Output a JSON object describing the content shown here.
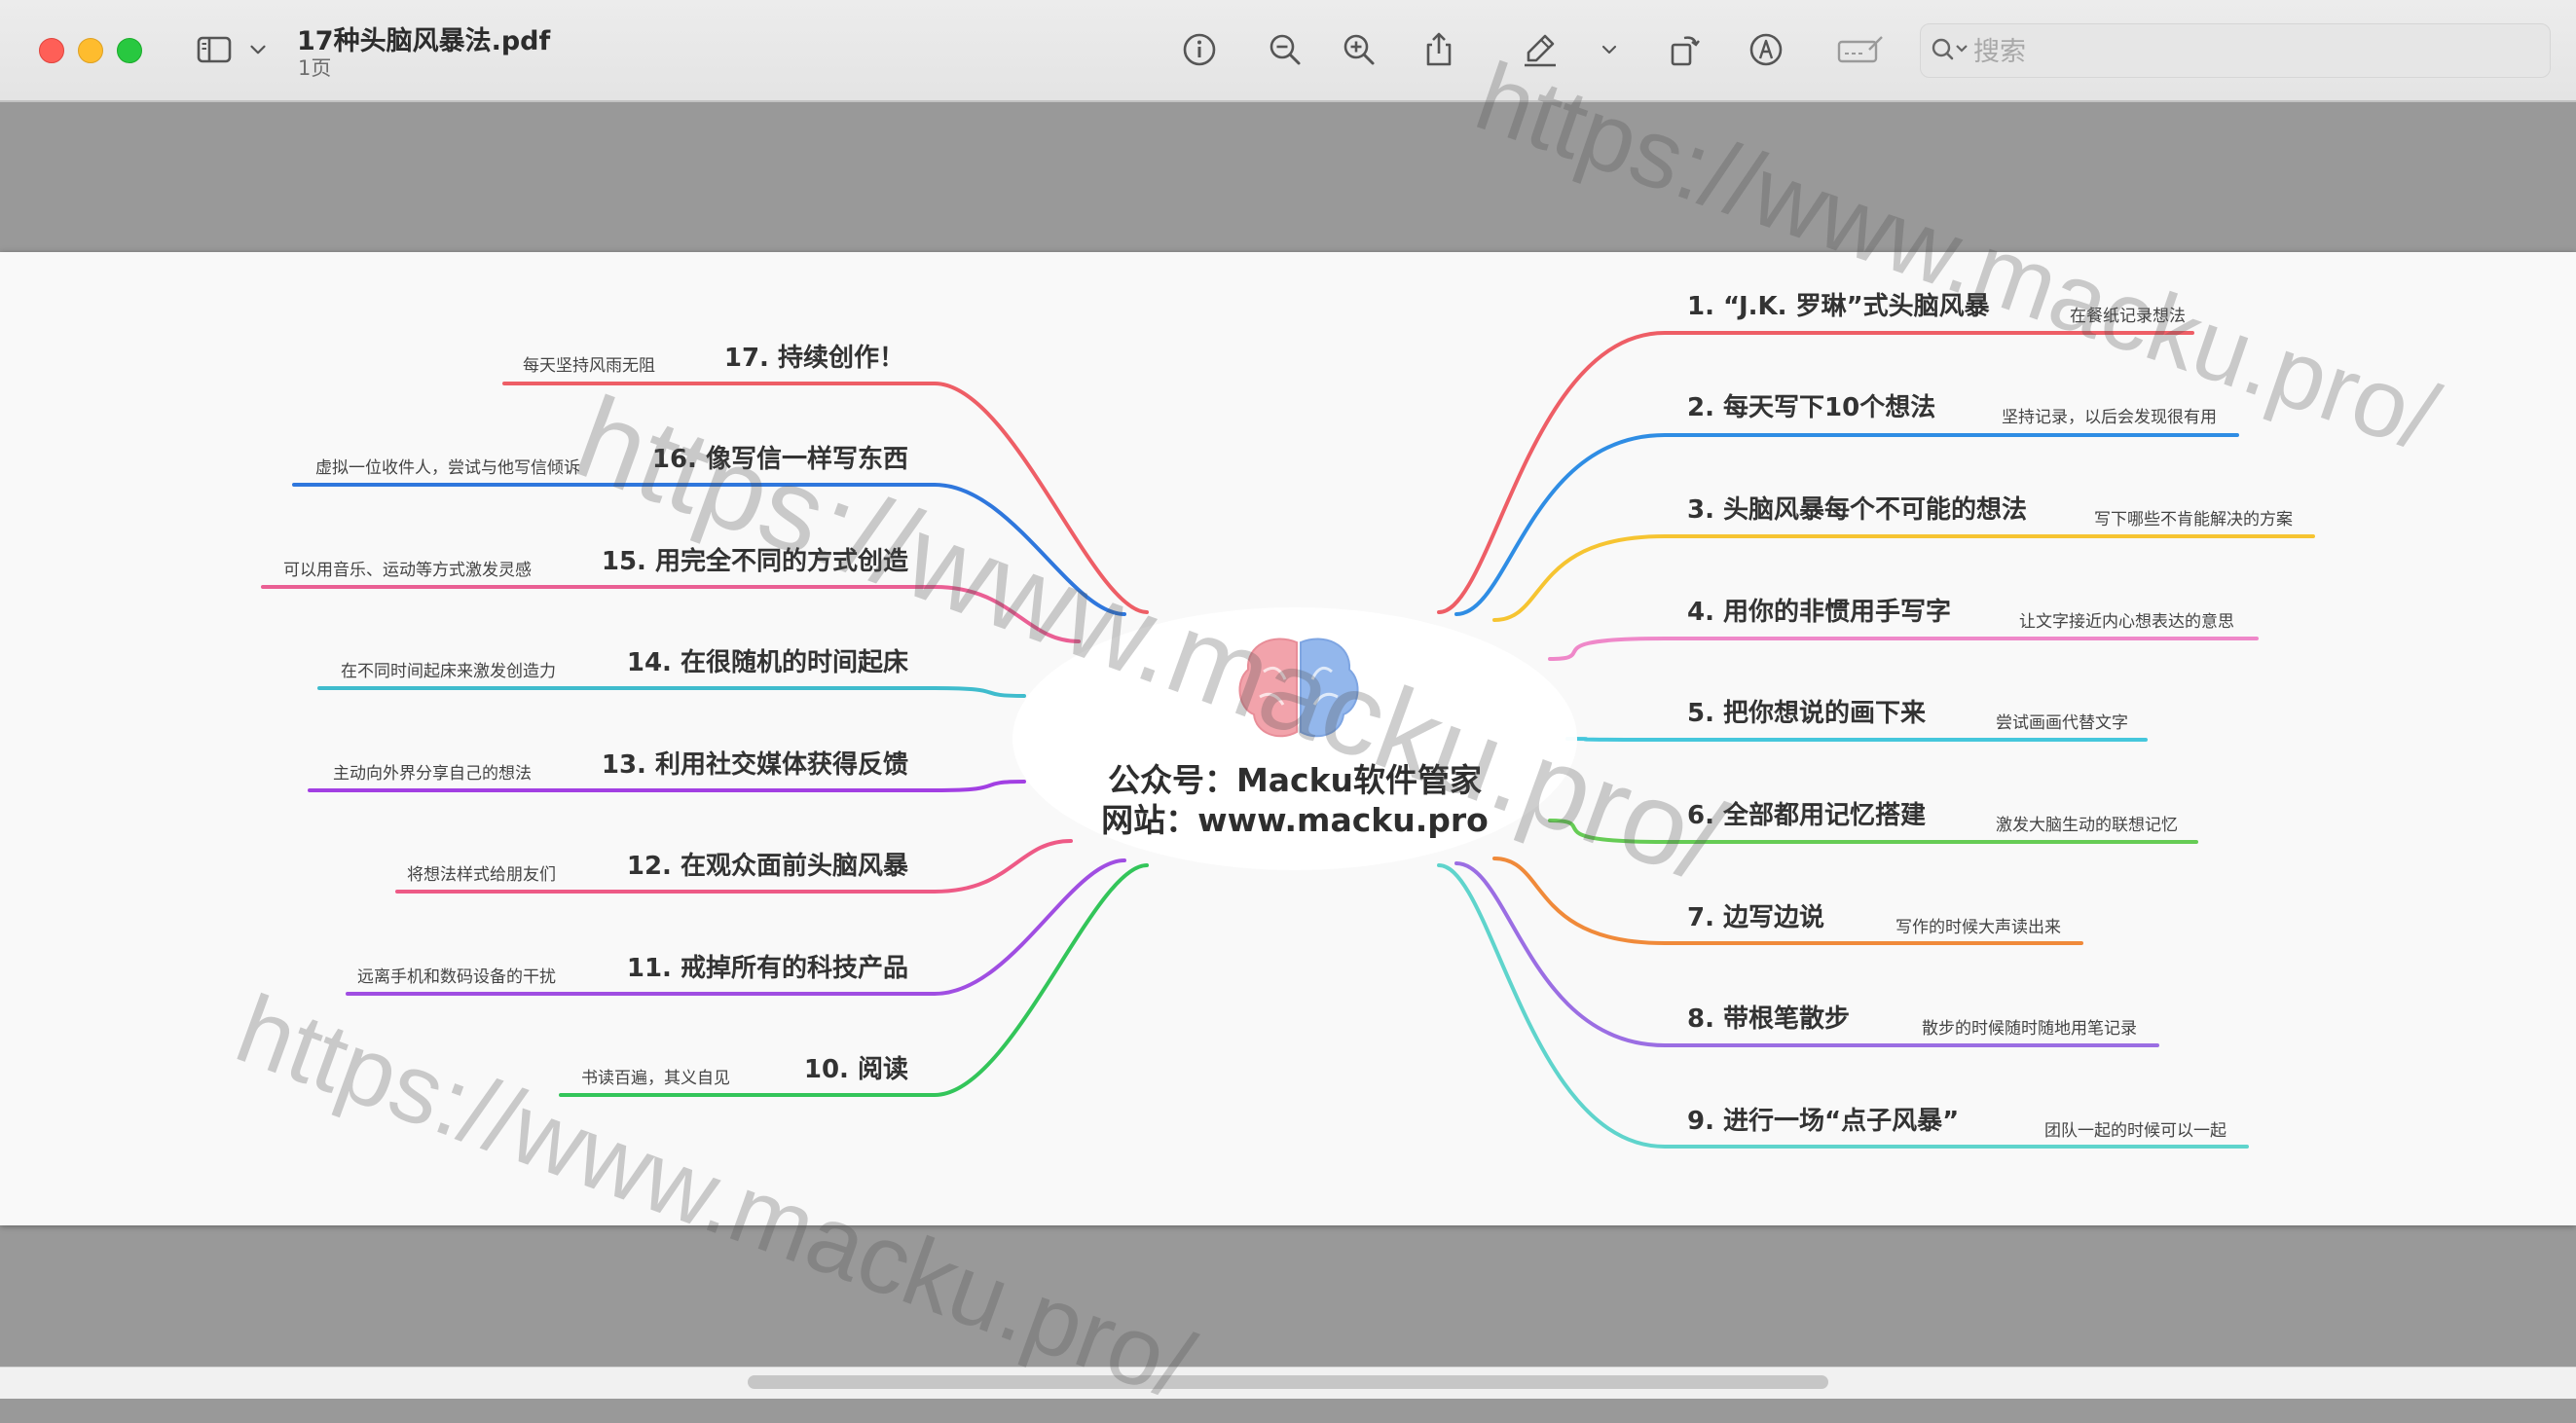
{
  "window": {
    "file_name": "17种头脑风暴法.pdf",
    "page_count": "1页",
    "search_placeholder": "搜索"
  },
  "toolbar_icons": [
    "sidebar-toggle-icon",
    "chevron-down-icon",
    "info-icon",
    "zoom-out-icon",
    "zoom-in-icon",
    "share-icon",
    "highlight-pen-icon",
    "chevron-down-icon",
    "rotate-icon",
    "markup-icon",
    "form-fill-icon",
    "search-icon"
  ],
  "colors": {
    "branches": [
      "#ee5e66",
      "#2f8de4",
      "#f6c431",
      "#ef88c9",
      "#45c7dc",
      "#66cc55",
      "#f08a3a",
      "#9b6ee3",
      "#5fd4cc",
      "#33c55a",
      "#a04ee2",
      "#ee5a86",
      "#a23fe3",
      "#3fbccd",
      "#ea5f94",
      "#2f77dd",
      "#ee5e66"
    ]
  },
  "mindmap": {
    "center": {
      "line1": "公众号：Macku软件管家",
      "line2": "网站：www.macku.pro"
    },
    "right_nodes": [
      {
        "title": "1. “J.K. 罗琳”式头脑风暴",
        "note": "在餐纸记录想法"
      },
      {
        "title": "2. 每天写下10个想法",
        "note": "坚持记录，以后会发现很有用"
      },
      {
        "title": "3. 头脑风暴每个不可能的想法",
        "note": "写下哪些不肯能解决的方案"
      },
      {
        "title": "4. 用你的非惯用手写字",
        "note": "让文字接近内心想表达的意思"
      },
      {
        "title": "5. 把你想说的画下来",
        "note": "尝试画画代替文字"
      },
      {
        "title": "6. 全部都用记忆搭建",
        "note": "激发大脑生动的联想记忆"
      },
      {
        "title": "7. 边写边说",
        "note": "写作的时候大声读出来"
      },
      {
        "title": "8. 带根笔散步",
        "note": "散步的时候随时随地用笔记录"
      },
      {
        "title": "9. 进行一场“点子风暴”",
        "note": "团队一起的时候可以一起"
      }
    ],
    "left_nodes": [
      {
        "title": "17. 持续创作！",
        "note": "每天坚持风雨无阻"
      },
      {
        "title": "16. 像写信一样写东西",
        "note": "虚拟一位收件人，尝试与他写信倾诉"
      },
      {
        "title": "15. 用完全不同的方式创造",
        "note": "可以用音乐、运动等方式激发灵感"
      },
      {
        "title": "14. 在很随机的时间起床",
        "note": "在不同时间起床来激发创造力"
      },
      {
        "title": "13. 利用社交媒体获得反馈",
        "note": "主动向外界分享自己的想法"
      },
      {
        "title": "12. 在观众面前头脑风暴",
        "note": "将想法样式给朋友们"
      },
      {
        "title": "11. 戒掉所有的科技产品",
        "note": "远离手机和数码设备的干扰"
      },
      {
        "title": "10. 阅读",
        "note": "书读百遍，其义自见"
      }
    ]
  },
  "watermark_text": "https://www.macku.pro/"
}
